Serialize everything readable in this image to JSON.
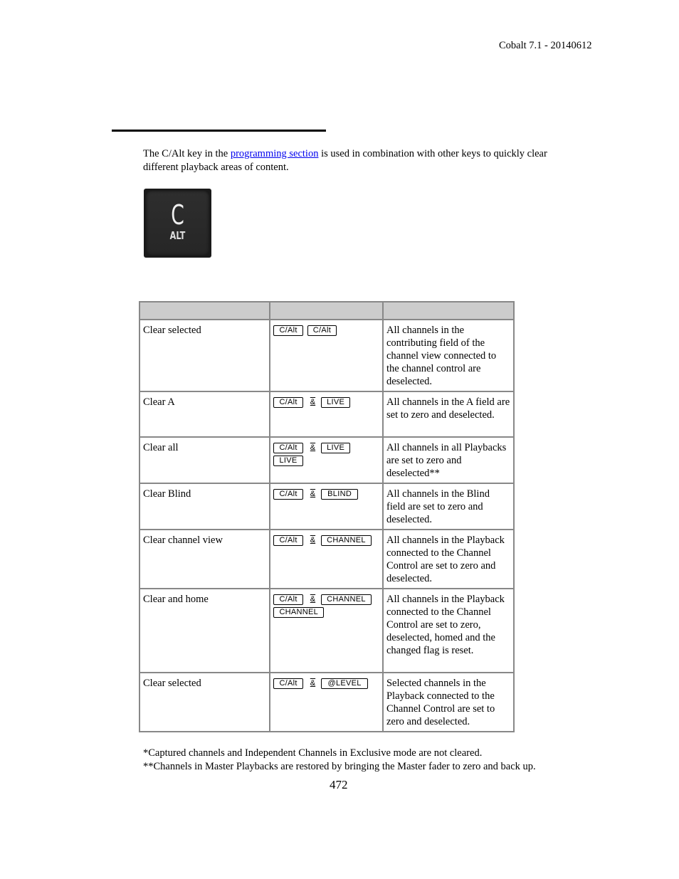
{
  "header": {
    "doc_version": "Cobalt 7.1 - 20140612"
  },
  "intro": {
    "text_before": "The C/Alt key in the ",
    "link_text": "programming section",
    "text_after": " is used in combination with other keys to quickly clear different playback areas of content."
  },
  "key_image": {
    "main_label": "C",
    "sub_label": "ALT"
  },
  "table": {
    "headers": [
      "",
      "",
      ""
    ],
    "rows": [
      {
        "function": "Clear selected",
        "keys_line1": [
          "C/Alt",
          "C/Alt"
        ],
        "amp": "",
        "keys_line2": [],
        "description": "All channels in the contributing field of the channel view connected to the channel control are deselected."
      },
      {
        "function": "Clear A",
        "keys_line1": [
          "C/Alt",
          "LIVE"
        ],
        "amp": "&",
        "keys_line2": [],
        "description": "All channels in the A field are set to zero and deselected."
      },
      {
        "function": "Clear all",
        "keys_line1": [
          "C/Alt",
          "LIVE"
        ],
        "amp": "&",
        "keys_line2": [
          "LIVE"
        ],
        "description": "All channels in all Playbacks are set to zero and deselected**"
      },
      {
        "function": "Clear Blind",
        "keys_line1": [
          "C/Alt",
          "BLIND"
        ],
        "amp": "&",
        "keys_line2": [],
        "description": "All channels in the Blind field are set to zero and deselected."
      },
      {
        "function": "Clear channel view",
        "keys_line1": [
          "C/Alt",
          "CHANNEL"
        ],
        "amp": "&",
        "keys_line2": [],
        "description": "All channels in the Playback connected to the Channel Control are set to zero and deselected."
      },
      {
        "function": "Clear and home",
        "keys_line1": [
          "C/Alt",
          "CHANNEL"
        ],
        "amp": "&",
        "keys_line2": [
          "CHANNEL"
        ],
        "description": "All channels in the Playback connected to the Channel Control are set to zero, deselected, homed and the changed flag is reset."
      },
      {
        "function": "Clear selected",
        "keys_line1": [
          "C/Alt",
          "@LEVEL"
        ],
        "amp": "&",
        "keys_line2": [],
        "description": "Selected channels in the Playback connected to the Channel Control are set to zero and deselected."
      }
    ]
  },
  "footnotes": [
    "*Captured channels and Independent Channels in Exclusive mode are not cleared.",
    "**Channels in Master Playbacks are restored by bringing the Master fader to zero and back up."
  ],
  "page_number": "472"
}
